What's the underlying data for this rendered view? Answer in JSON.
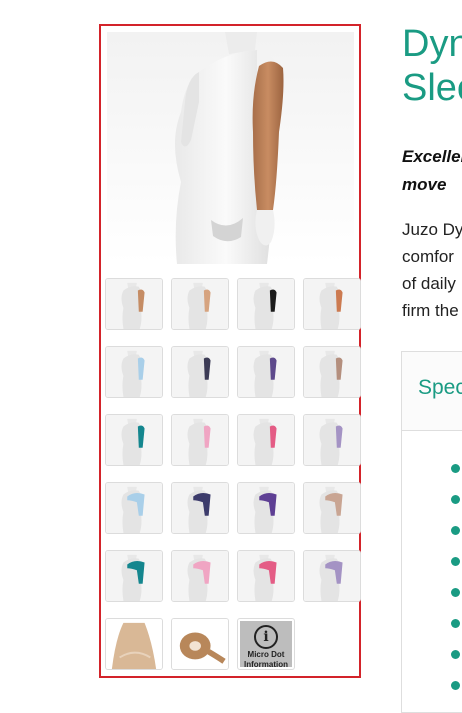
{
  "product": {
    "title_line1": "Dyn",
    "title_line2": "Slee",
    "tagline_line1": "Excellen",
    "tagline_line2": "move",
    "description_lines": [
      "Juzo Dy",
      "comfor",
      "of daily",
      "firm the"
    ]
  },
  "specs": {
    "heading": "Spec",
    "bullet_count": 8
  },
  "gallery": {
    "main_image_alt": "Mannequin wearing a beige compression arm sleeve",
    "thumbnails": [
      {
        "color": "#c58c64",
        "style": "sleeve"
      },
      {
        "color": "#d6a37f",
        "style": "sleeve"
      },
      {
        "color": "#1b1b1b",
        "style": "sleeve"
      },
      {
        "color": "#cc7a50",
        "style": "sleeve"
      },
      {
        "color": "#a9cfe9",
        "style": "sleeve"
      },
      {
        "color": "#3c3b55",
        "style": "sleeve"
      },
      {
        "color": "#5e4a8c",
        "style": "sleeve"
      },
      {
        "color": "#b48f7e",
        "style": "sleeve"
      },
      {
        "color": "#14868e",
        "style": "sleeve"
      },
      {
        "color": "#f0a5c3",
        "style": "sleeve"
      },
      {
        "color": "#e45c85",
        "style": "sleeve"
      },
      {
        "color": "#a493c4",
        "style": "sleeve"
      },
      {
        "color": "#a9cfe9",
        "style": "shoulder"
      },
      {
        "color": "#3c3b6b",
        "style": "shoulder"
      },
      {
        "color": "#5e3f94",
        "style": "shoulder"
      },
      {
        "color": "#c9a593",
        "style": "shoulder"
      },
      {
        "color": "#14868e",
        "style": "shoulder"
      },
      {
        "color": "#f0a5c3",
        "style": "shoulder"
      },
      {
        "color": "#e45c85",
        "style": "shoulder"
      },
      {
        "color": "#a493c4",
        "style": "shoulder"
      },
      {
        "color": "#d9b896",
        "style": "closeup"
      },
      {
        "color": "#b8875a",
        "style": "roll"
      }
    ],
    "info_tile": {
      "line1": "Micro Dot",
      "line2": "Information"
    }
  },
  "colors": {
    "accent": "#1a9b83",
    "highlight_border": "#d3232a"
  }
}
